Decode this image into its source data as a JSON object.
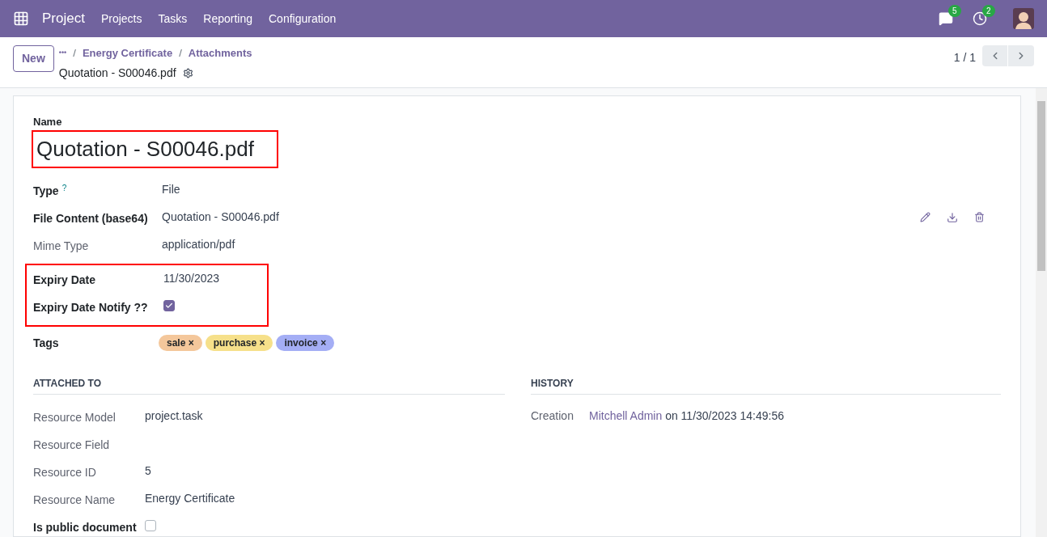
{
  "navbar": {
    "app": "Project",
    "menu": [
      "Projects",
      "Tasks",
      "Reporting",
      "Configuration"
    ],
    "messages_count": "5",
    "activities_count": "2"
  },
  "control_panel": {
    "new_button": "New",
    "breadcrumb_more": "•••",
    "breadcrumb_separator": "/",
    "breadcrumbs": [
      "Energy Certificate",
      "Attachments"
    ],
    "record_title": "Quotation - S00046.pdf",
    "pager": "1 / 1"
  },
  "form": {
    "name_label": "Name",
    "name": "Quotation - S00046.pdf",
    "name_highlighted": true,
    "fields": [
      {
        "kind": "text",
        "label": "Type",
        "help": "?",
        "readonly": false,
        "value": "File"
      },
      {
        "kind": "file",
        "label": "File Content (base64)",
        "readonly": false,
        "value": "Quotation - S00046.pdf"
      },
      {
        "kind": "text",
        "label": "Mime Type",
        "readonly": true,
        "value": "application/pdf"
      }
    ],
    "highlighted_fields": [
      {
        "kind": "text",
        "label": "Expiry Date",
        "readonly": false,
        "value": "11/30/2023"
      },
      {
        "kind": "checkbox",
        "label": "Expiry Date Notify ??",
        "readonly": false,
        "checked": true
      }
    ],
    "tags_label": "Tags",
    "tag_remove": "×",
    "tags": [
      {
        "name": "sale",
        "color": "#f4c79b"
      },
      {
        "name": "purchase",
        "color": "#f6e08a"
      },
      {
        "name": "invoice",
        "color": "#a4aef5"
      }
    ],
    "attached_to": {
      "title": "ATTACHED TO",
      "fields": [
        {
          "kind": "text",
          "label": "Resource Model",
          "readonly": true,
          "value": "project.task"
        },
        {
          "kind": "text",
          "label": "Resource Field",
          "readonly": true
        },
        {
          "kind": "text",
          "label": "Resource ID",
          "readonly": true,
          "value": "5"
        },
        {
          "kind": "text",
          "label": "Resource Name",
          "readonly": true,
          "value": "Energy Certificate"
        },
        {
          "kind": "checkbox",
          "label": "Is public document",
          "readonly": false,
          "checked": false
        }
      ]
    },
    "history": {
      "title": "HISTORY",
      "label": "Creation",
      "user": "Mitchell Admin",
      "rest": "on 11/30/2023 14:49:56"
    }
  }
}
